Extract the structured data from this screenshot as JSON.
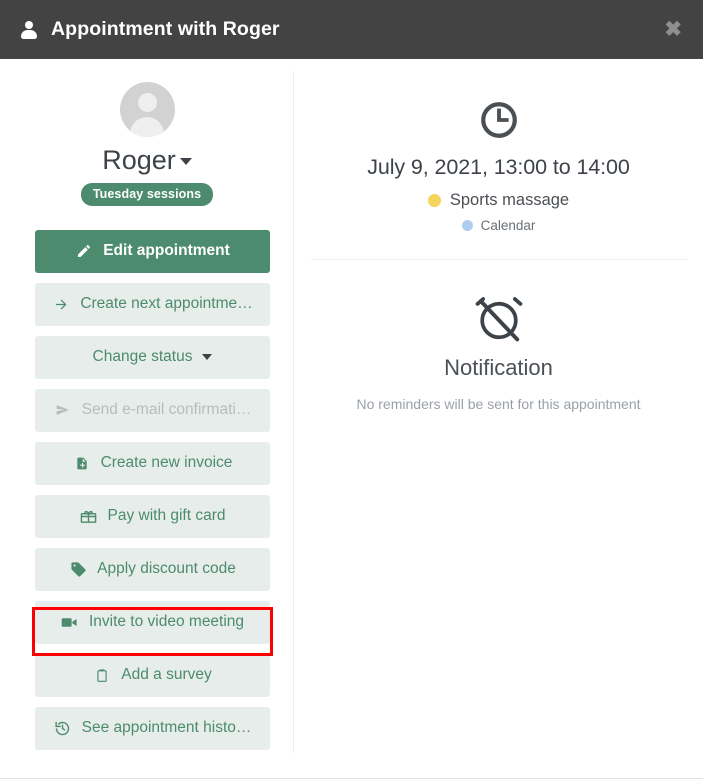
{
  "header": {
    "title": "Appointment with Roger",
    "person_icon": "person-icon",
    "close_label": "✖"
  },
  "profile": {
    "avatar": "avatar-placeholder",
    "name": "Roger",
    "badge": "Tuesday sessions"
  },
  "actions": [
    {
      "id": "edit-appointment",
      "label": "Edit appointment",
      "icon": "pencil-icon",
      "style": "primary",
      "disabled": false
    },
    {
      "id": "create-next-appointment",
      "label": "Create next appointme…",
      "icon": "arrow-right-icon",
      "style": "default",
      "disabled": false
    },
    {
      "id": "change-status",
      "label": "Change status",
      "icon": "none",
      "style": "dropdown",
      "disabled": false
    },
    {
      "id": "send-email-confirmation",
      "label": "Send e-mail confirmati…",
      "icon": "send-icon",
      "style": "default",
      "disabled": true
    },
    {
      "id": "create-new-invoice",
      "label": "Create new invoice",
      "icon": "invoice-icon",
      "style": "default",
      "disabled": false
    },
    {
      "id": "pay-with-gift-card",
      "label": "Pay with gift card",
      "icon": "gift-card-icon",
      "style": "default",
      "disabled": false
    },
    {
      "id": "apply-discount-code",
      "label": "Apply discount code",
      "icon": "tag-icon",
      "style": "default",
      "disabled": false,
      "highlighted": true
    },
    {
      "id": "invite-to-video-meeting",
      "label": "Invite to video meeting",
      "icon": "video-camera-icon",
      "style": "default",
      "disabled": false
    },
    {
      "id": "add-a-survey",
      "label": "Add a survey",
      "icon": "clipboard-icon",
      "style": "default",
      "disabled": false
    },
    {
      "id": "see-appointment-history",
      "label": "See appointment histo…",
      "icon": "history-icon",
      "style": "default",
      "disabled": false
    }
  ],
  "appointment": {
    "icon": "clock-icon",
    "datetime": "July 9, 2021, 13:00 to 14:00",
    "service": "Sports massage",
    "service_color": "#f5d65b",
    "calendar": "Calendar",
    "calendar_color": "#aecdf0"
  },
  "notification": {
    "icon": "alarm-off-icon",
    "title": "Notification",
    "message": "No reminders will be sent for this appointment"
  },
  "colors": {
    "header_bg": "#434343",
    "accent_green": "#4c8b6d",
    "button_bg": "#e7edea",
    "highlight_red": "#ff0000"
  }
}
